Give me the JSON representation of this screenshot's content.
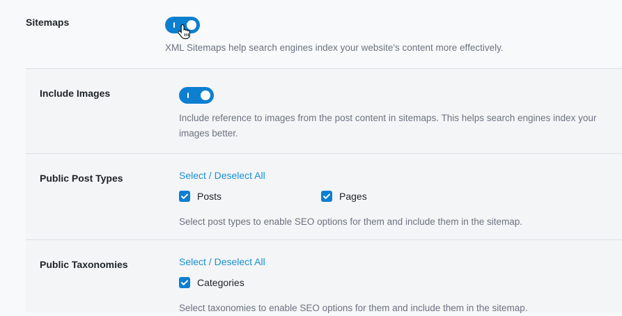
{
  "sitemaps": {
    "label": "Sitemaps",
    "enabled": true,
    "description": "XML Sitemaps help search engines index your website's content more effectively."
  },
  "include_images": {
    "label": "Include Images",
    "enabled": true,
    "description_line1": "Include reference to images from the post content in sitemaps. This helps search engines index your",
    "description_line2": "images better."
  },
  "post_types": {
    "label": "Public Post Types",
    "select_link": "Select / Deselect All",
    "options": [
      {
        "label": "Posts",
        "checked": true
      },
      {
        "label": "Pages",
        "checked": true
      }
    ],
    "description": "Select post types to enable SEO options for them and include them in the sitemap."
  },
  "taxonomies": {
    "label": "Public Taxonomies",
    "select_link": "Select / Deselect All",
    "options": [
      {
        "label": "Categories",
        "checked": true
      }
    ],
    "description": "Select taxonomies to enable SEO options for them and include them in the sitemap."
  },
  "colors": {
    "accent": "#0c7fd0",
    "link": "#1a8fd3",
    "muted_text": "#6b7280"
  },
  "icons": {
    "cursor": "hand-pointer-icon",
    "checkmark": "checkmark-icon"
  }
}
